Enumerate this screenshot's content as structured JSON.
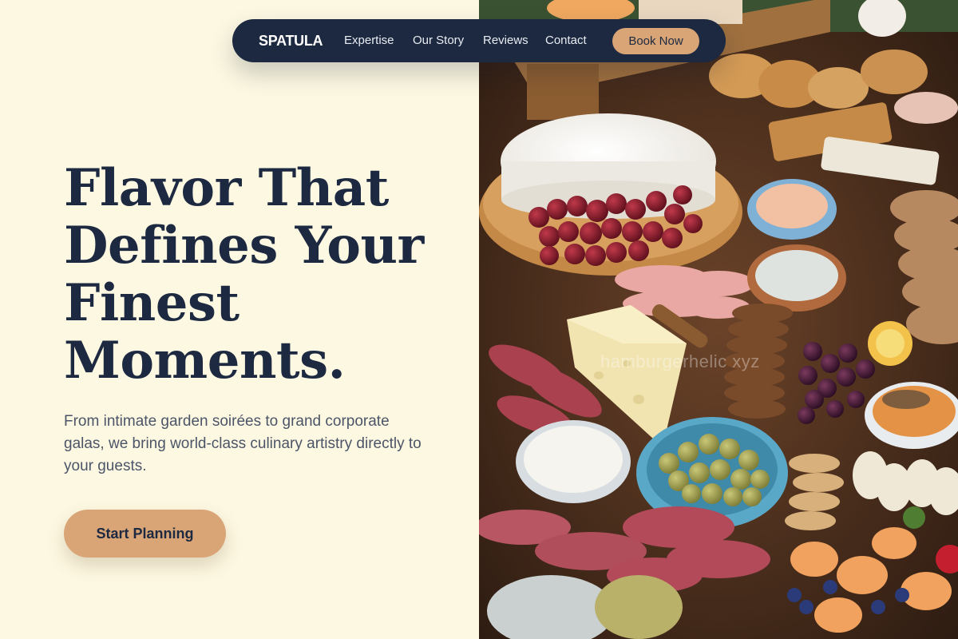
{
  "nav": {
    "logo": "SPATULA",
    "links": [
      "Expertise",
      "Our Story",
      "Reviews",
      "Contact"
    ],
    "cta": "Book Now"
  },
  "hero": {
    "headline_lines": [
      "Flavor That",
      "Defines Your",
      "Finest",
      "Moments."
    ],
    "subtext": "From intimate garden soirées to grand corporate galas, we bring world-class culinary artistry directly to your guests.",
    "cta": "Start Planning"
  },
  "image": {
    "description_icon": "charcuterie-board-photo",
    "watermark": "hamburgerhelic xyz"
  },
  "colors": {
    "background": "#fdf8e2",
    "navy": "#1c2940",
    "accent": "#d9a577",
    "body_text": "#4c5568"
  }
}
